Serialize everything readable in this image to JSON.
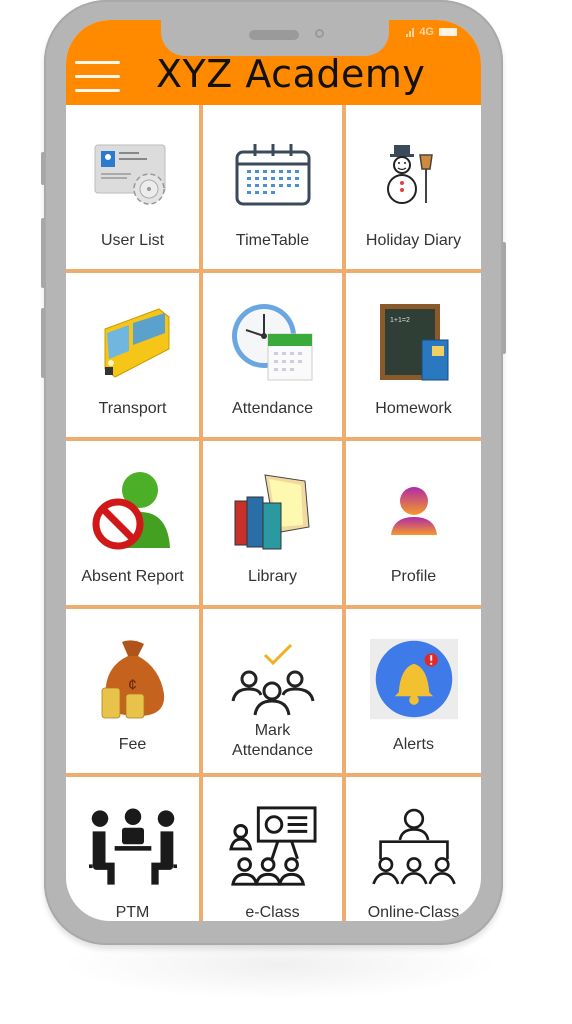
{
  "status_bar": {
    "network": "4G"
  },
  "header": {
    "title": "XYZ Academy",
    "menu_icon": "hamburger-menu-icon",
    "background_color": "#ff8a00"
  },
  "grid": {
    "line_color": "#eeac6e",
    "tiles": [
      {
        "label": "User List",
        "icon": "id-card-gear-icon"
      },
      {
        "label": "TimeTable",
        "icon": "calendar-icon"
      },
      {
        "label": "Holiday Diary",
        "icon": "snowman-icon"
      },
      {
        "label": "Transport",
        "icon": "school-bus-icon"
      },
      {
        "label": "Attendance",
        "icon": "clock-calendar-icon"
      },
      {
        "label": "Homework",
        "icon": "chalkboard-book-icon"
      },
      {
        "label": "Absent Report",
        "icon": "user-blocked-icon"
      },
      {
        "label": "Library",
        "icon": "books-folder-icon"
      },
      {
        "label": "Profile",
        "icon": "user-profile-icon"
      },
      {
        "label": "Fee",
        "icon": "money-bag-icon"
      },
      {
        "label": "Mark Attendance",
        "label_line1": "Mark",
        "label_line2": "Attendance",
        "icon": "group-check-icon"
      },
      {
        "label": "Alerts",
        "icon": "bell-alert-icon"
      },
      {
        "label": "PTM",
        "icon": "meeting-table-icon"
      },
      {
        "label": "e-Class",
        "icon": "presentation-class-icon"
      },
      {
        "label": "Online-Class",
        "icon": "online-class-icon"
      }
    ]
  }
}
